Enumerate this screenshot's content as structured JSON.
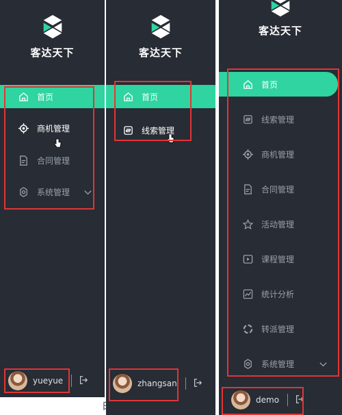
{
  "brand": "客达天下",
  "colors": {
    "sidebar_bg": "#272c35",
    "accent": "#2fd4a0",
    "text": "#9aa0a8",
    "highlight": "#e23535"
  },
  "panels": [
    {
      "user": "yueyue",
      "menu": [
        {
          "label": "首页",
          "icon": "home-icon"
        },
        {
          "label": "商机管理",
          "icon": "target-icon"
        },
        {
          "label": "合同管理",
          "icon": "document-icon"
        },
        {
          "label": "系统管理",
          "icon": "gear-icon"
        }
      ]
    },
    {
      "user": "zhangsan",
      "menu": [
        {
          "label": "首页",
          "icon": "home-icon"
        },
        {
          "label": "线索管理",
          "icon": "clue-icon"
        }
      ]
    },
    {
      "user": "demo",
      "menu": [
        {
          "label": "首页",
          "icon": "home-icon"
        },
        {
          "label": "线索管理",
          "icon": "clue-icon"
        },
        {
          "label": "商机管理",
          "icon": "target-icon"
        },
        {
          "label": "合同管理",
          "icon": "document-icon"
        },
        {
          "label": "活动管理",
          "icon": "star-icon"
        },
        {
          "label": "课程管理",
          "icon": "play-icon"
        },
        {
          "label": "统计分析",
          "icon": "chart-icon"
        },
        {
          "label": "转派管理",
          "icon": "transfer-icon"
        },
        {
          "label": "系统管理",
          "icon": "gear-icon"
        }
      ]
    }
  ],
  "background_text": "时间"
}
